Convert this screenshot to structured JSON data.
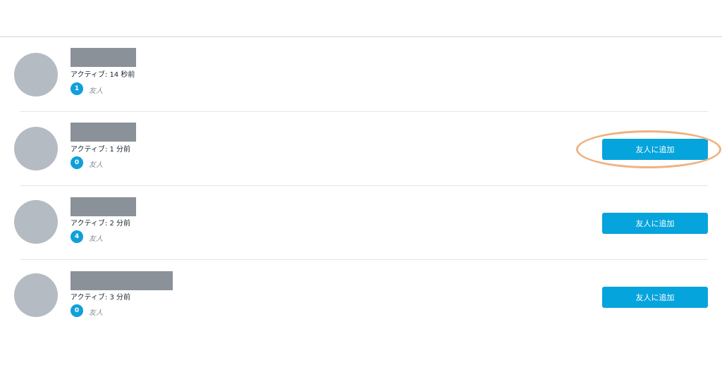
{
  "users": [
    {
      "activity": "アクティブ: 14 秒前",
      "friend_count": "1",
      "friend_label": "友人"
    },
    {
      "activity": "アクティブ: 1 分前",
      "friend_count": "0",
      "friend_label": "友人",
      "button_label": "友人に追加"
    },
    {
      "activity": "アクティブ: 2 分前",
      "friend_count": "4",
      "friend_label": "友人",
      "button_label": "友人に追加"
    },
    {
      "activity": "アクティブ: 3 分前",
      "friend_count": "0",
      "friend_label": "友人",
      "button_label": "友人に追加"
    }
  ],
  "colors": {
    "accent": "#06a4dc",
    "badge": "#10a0d9",
    "avatar": "#b5bbc3",
    "redaction": "#8a9199",
    "highlight": "#efb282"
  }
}
